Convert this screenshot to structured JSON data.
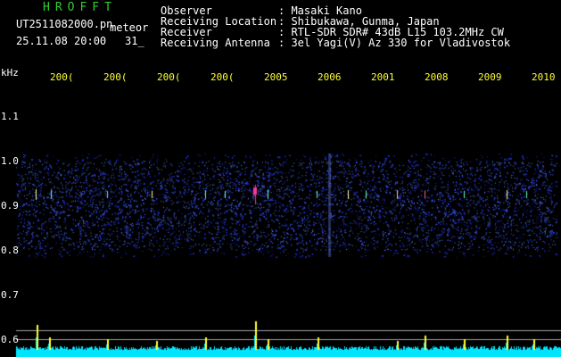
{
  "header": {
    "brand": "HROFFT",
    "filename": "UT2511082000.pn",
    "meteor_label": "meteor",
    "datetime": "25.11.08 20:00",
    "count": "31_",
    "info": [
      {
        "label": "Observer",
        "value": ": Masaki Kano"
      },
      {
        "label": "Receiving Location",
        "value": ": Shibukawa, Gunma, Japan"
      },
      {
        "label": "Receiver",
        "value": ": RTL-SDR SDR# 43dB L15 103.2MHz CW"
      },
      {
        "label": "Receiving Antenna",
        "value": ": 3el Yagi(V) Az 330 for Vladivostok"
      }
    ]
  },
  "time_axis": [
    "200(",
    "200(",
    "200(",
    "200(",
    "2005",
    "2006",
    "2001",
    "2008",
    "2009",
    "2010"
  ],
  "freq_axis": {
    "unit": "kHz",
    "ticks": [
      "1.1",
      "1.0",
      "0.9",
      "0.8",
      "0.7",
      "0.6"
    ]
  },
  "colors": {
    "background": "#000000",
    "text": "#ffffff",
    "brand": "#2fd02f",
    "time_labels": "#ffff33",
    "noise_band": "#1a2a9a",
    "baseline": "#00e5ff",
    "grid_line": "#b0b0b0"
  }
}
